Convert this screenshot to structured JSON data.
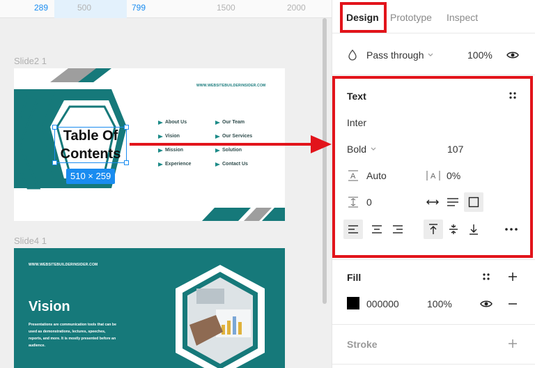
{
  "ruler": {
    "marks": [
      "289",
      "500",
      "799",
      "1500",
      "2000"
    ]
  },
  "canvas": {
    "slide2": {
      "label": "Slide2 1",
      "url": "WWW.WEBSITEBUILDERINSIDER.COM",
      "title": "Table Of Contents",
      "title_line1": "Table Of",
      "title_line2": "Contents",
      "items_left": [
        "About Us",
        "Vision",
        "Mission",
        "Experience"
      ],
      "items_right": [
        "Our Team",
        "Our Services",
        "Solution",
        "Contact Us"
      ],
      "dimensions": "510 × 259"
    },
    "slide4": {
      "label": "Slide4 1",
      "url": "WWW.WEBSITEBUILDERINSIDER.COM",
      "title": "Vision",
      "description": "Presentations are communication tools that can be used as demonstrations, lectures, speeches, reports, and more. It is mostly presented before an audience."
    }
  },
  "panel": {
    "tabs": {
      "design": "Design",
      "prototype": "Prototype",
      "inspect": "Inspect"
    },
    "layer": {
      "blend": "Pass through",
      "opacity": "100%"
    },
    "text": {
      "heading": "Text",
      "font": "Inter",
      "weight": "Bold",
      "size": "107",
      "line_height": "Auto",
      "letter_spacing": "0%",
      "paragraph_spacing": "0"
    },
    "fill": {
      "heading": "Fill",
      "hex": "000000",
      "opacity": "100%",
      "color": "#000000"
    },
    "stroke": {
      "heading": "Stroke"
    }
  },
  "colors": {
    "accent": "#1a8cf0",
    "highlight": "#e2141b",
    "slide_teal": "#16797a"
  }
}
